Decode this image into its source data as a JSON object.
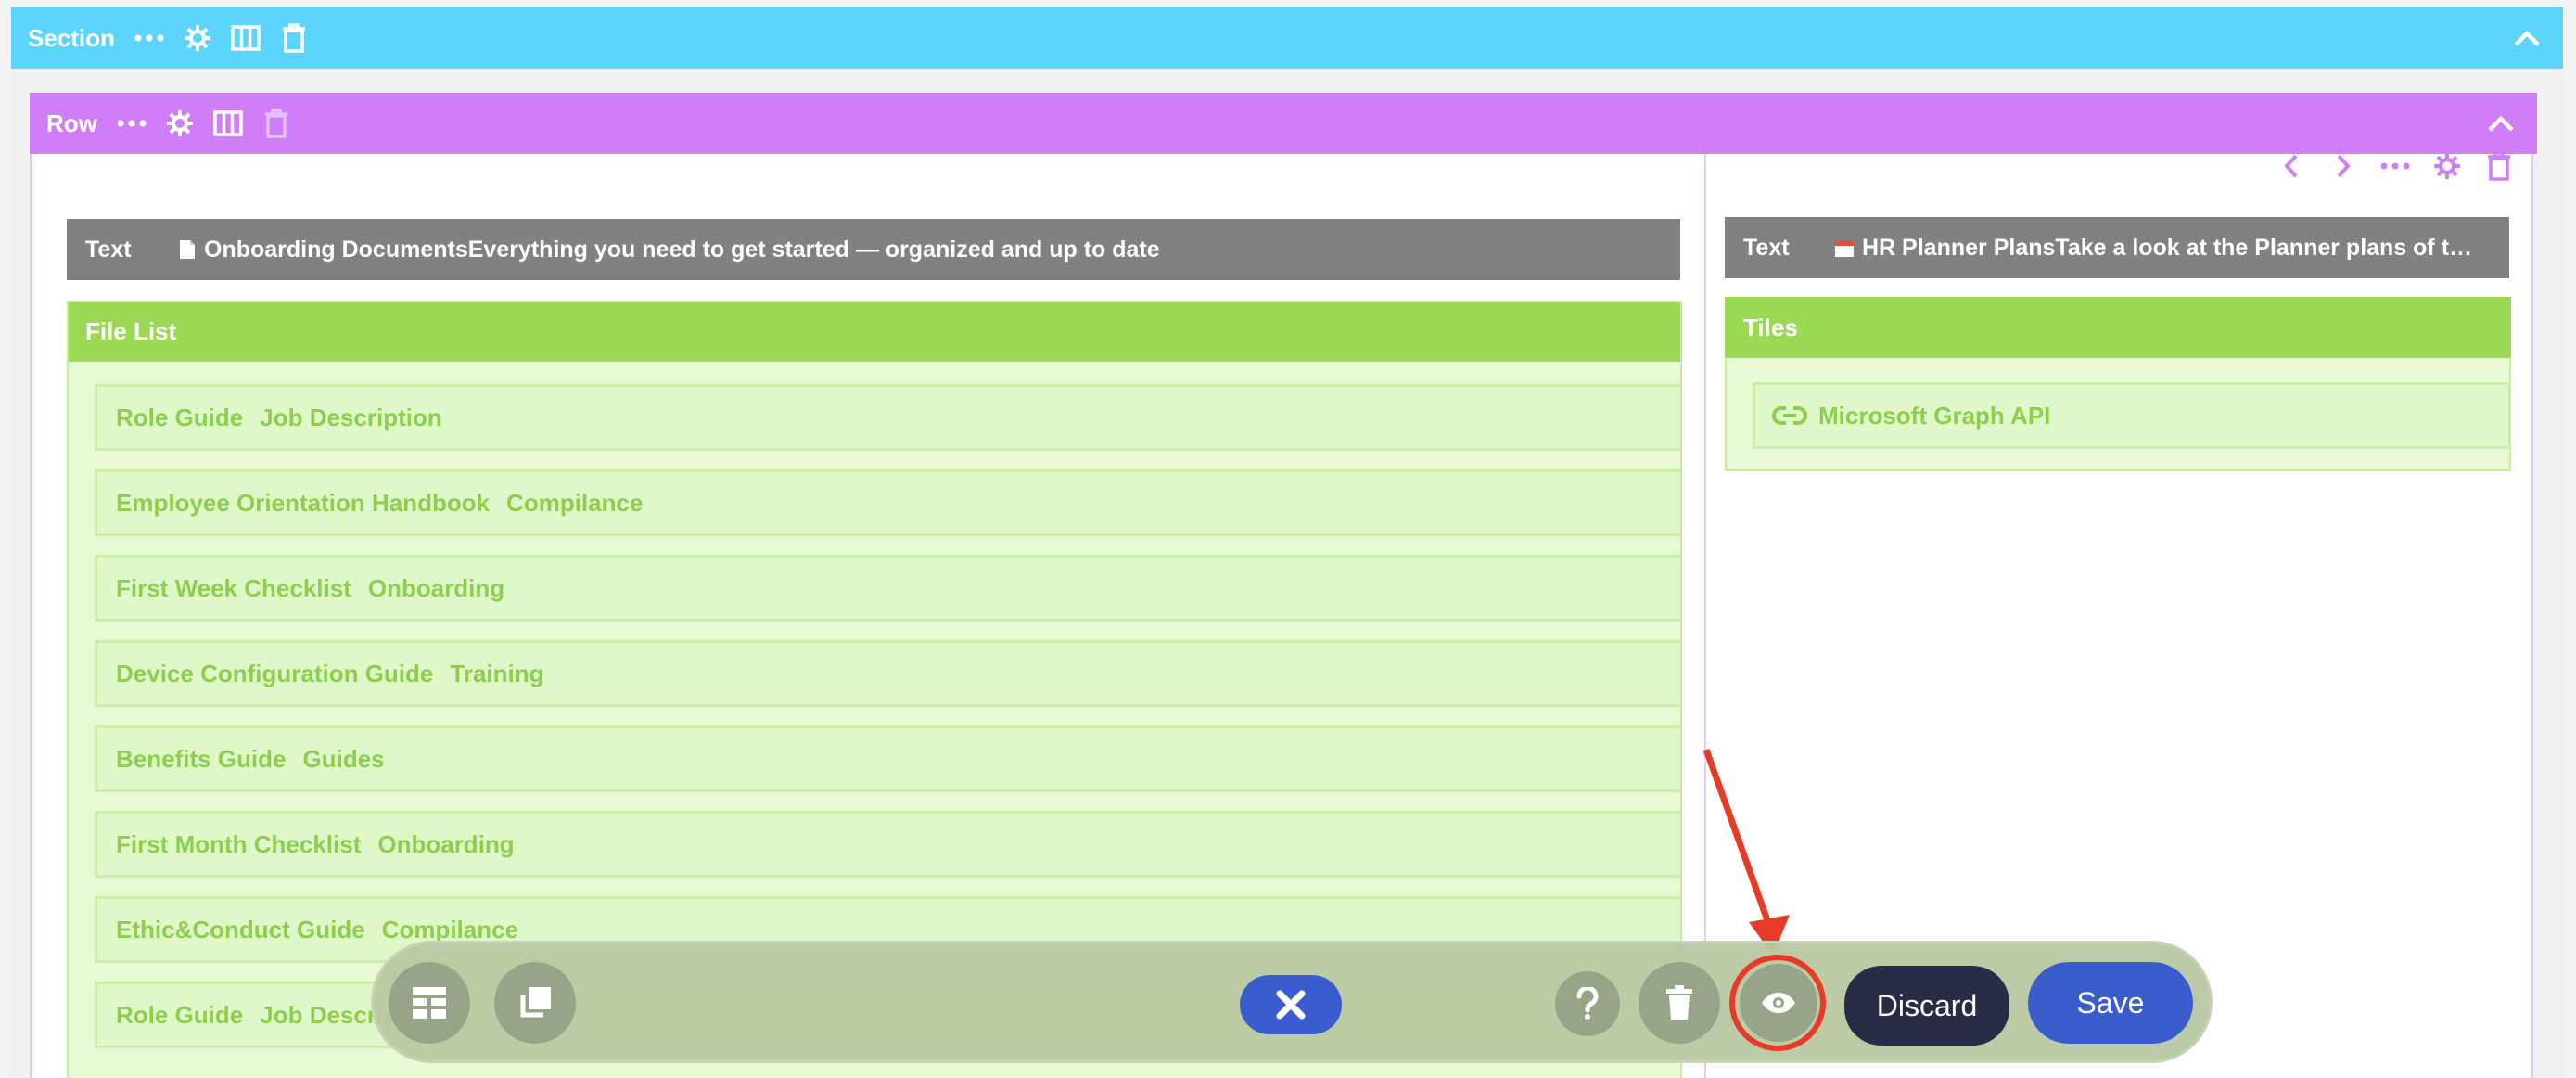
{
  "section": {
    "label": "Section"
  },
  "row": {
    "label": "Row"
  },
  "left_column": {
    "text_module": {
      "label": "Text",
      "title": "Onboarding Documents",
      "subtitle": "Everything you need to get started — organized and up to date"
    },
    "file_list": {
      "title": "File List",
      "items": [
        {
          "name": "Role Guide",
          "tag": "Job Description"
        },
        {
          "name": "Employee Orientation Handbook",
          "tag": "Compilance"
        },
        {
          "name": "First Week Checklist",
          "tag": "Onboarding"
        },
        {
          "name": "Device Configuration Guide",
          "tag": "Training"
        },
        {
          "name": "Benefits Guide",
          "tag": "Guides"
        },
        {
          "name": "First Month Checklist",
          "tag": "Onboarding"
        },
        {
          "name": "Ethic&Conduct Guide",
          "tag": "Compilance"
        },
        {
          "name": "Role Guide",
          "tag": "Job Description"
        }
      ]
    }
  },
  "right_column": {
    "text_module": {
      "label": "Text",
      "content": "HR Planner PlansTake a look at the Planner plans of the H..."
    },
    "tiles": {
      "title": "Tiles",
      "items": [
        {
          "label": "Microsoft Graph API"
        }
      ]
    }
  },
  "toolbar": {
    "discard_label": "Discard",
    "save_label": "Save"
  },
  "colors": {
    "section_bar": "#5dd4fb",
    "row_bar": "#cf7ef8",
    "text_module": "#818181",
    "green_header": "#9bd854",
    "green_text": "#8dcf4c",
    "save": "#3b5ccc",
    "discard": "#282c46",
    "highlight": "#e63b26"
  },
  "icons": {
    "section_bar": [
      "more-icon",
      "gear-icon",
      "columns-icon",
      "trash-icon",
      "chevron-up-icon"
    ],
    "column_tools": [
      "chevron-left-icon",
      "chevron-right-icon",
      "more-icon",
      "gear-icon",
      "trash-icon"
    ],
    "toolbar": [
      "layout-icon",
      "copy-icon",
      "close-icon",
      "help-icon",
      "trash-icon",
      "eye-icon"
    ]
  }
}
